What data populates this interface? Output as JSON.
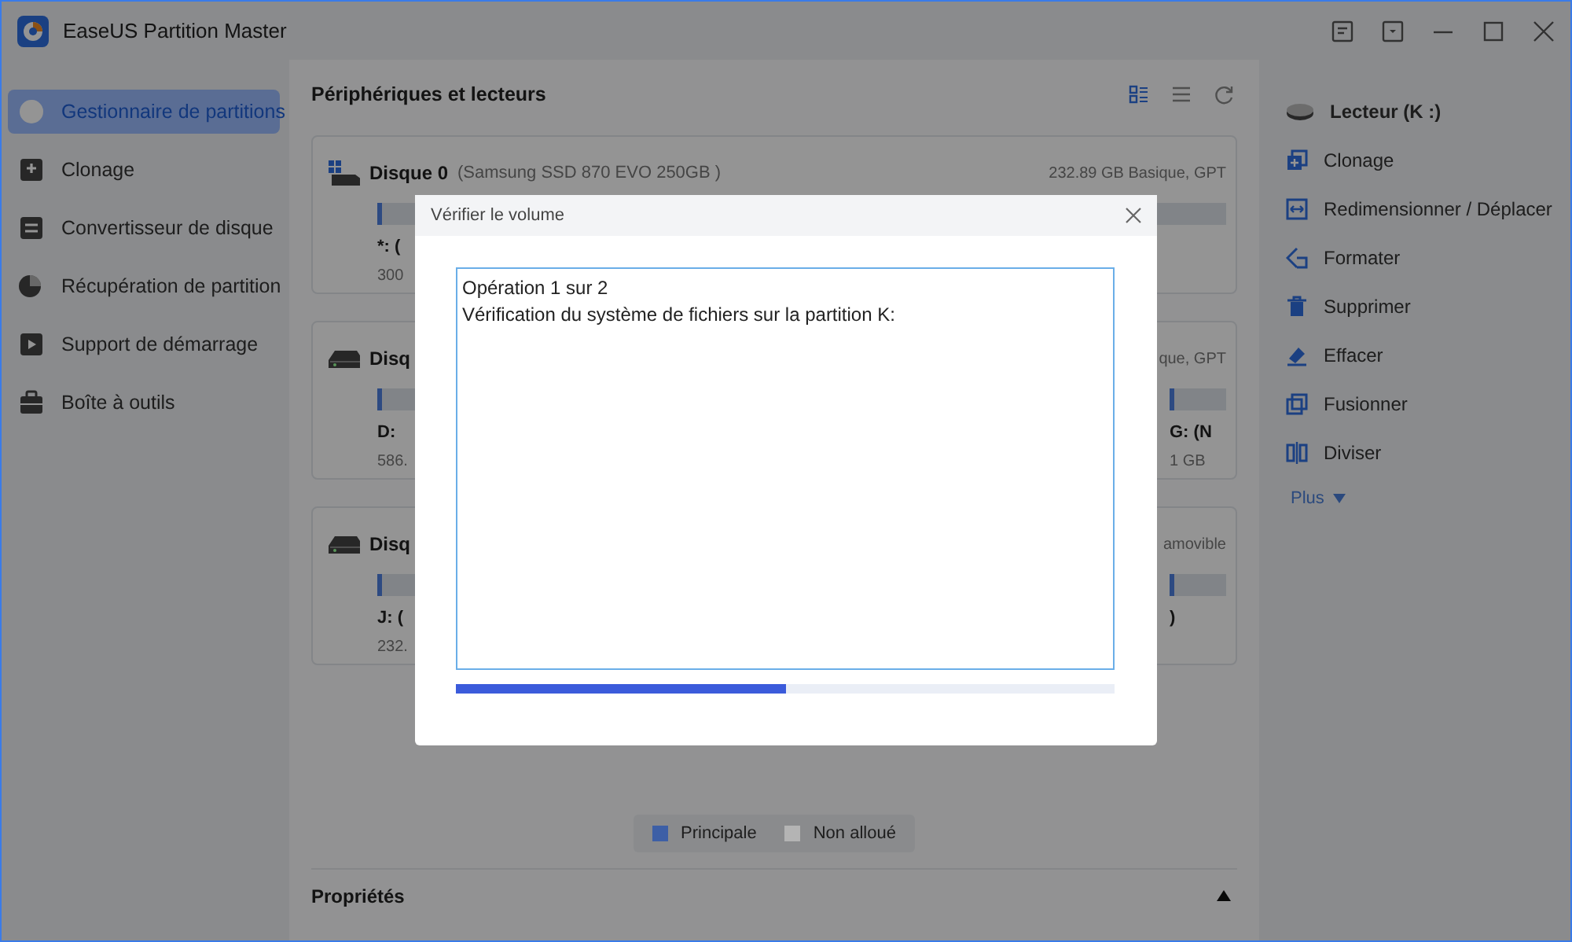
{
  "window": {
    "title": "EaseUS Partition Master"
  },
  "sidebar": {
    "items": [
      {
        "label": "Gestionnaire de partitions",
        "selected": true
      },
      {
        "label": "Clonage",
        "selected": false
      },
      {
        "label": "Convertisseur de disque",
        "selected": false
      },
      {
        "label": "Récupération de partition",
        "selected": false
      },
      {
        "label": "Support de démarrage",
        "selected": false
      },
      {
        "label": "Boîte à outils",
        "selected": false
      }
    ]
  },
  "main": {
    "title": "Périphériques et lecteurs",
    "view_buttons": [
      {
        "selected": true
      },
      {
        "selected": false
      }
    ]
  },
  "disks": [
    {
      "name": "Disque 0",
      "model": "(Samsung SSD 870 EVO 250GB )",
      "info": "232.89 GB Basique, GPT",
      "partitions": [
        {
          "label": "*: (",
          "size": "300"
        }
      ]
    },
    {
      "name": "Disq",
      "info": "que, GPT",
      "partitions": [
        {
          "label": "D:",
          "size": "586."
        },
        {
          "label": "G: (N",
          "size": "1 GB"
        }
      ]
    },
    {
      "name": "Disq",
      "info": "amovible",
      "partitions": [
        {
          "label": "J: (",
          "size": "232."
        },
        {
          "label": ")"
        }
      ]
    }
  ],
  "legend": [
    {
      "label": "Principale",
      "color": "#3d5fa6"
    },
    {
      "label": "Non alloué",
      "color": "#b4b4b4"
    }
  ],
  "properties": {
    "title": "Propriétés"
  },
  "actions": {
    "drive": "Lecteur (K :)",
    "items": [
      "Clonage",
      "Redimensionner / Déplacer",
      "Formater",
      "Supprimer",
      "Effacer",
      "Fusionner",
      "Diviser"
    ],
    "more": "Plus"
  },
  "dialog": {
    "title": "Vérifier le volume",
    "log": [
      "Opération 1 sur 2",
      "Vérification du système de fichiers sur la partition K:"
    ],
    "progress": {
      "level": 0.5
    }
  }
}
